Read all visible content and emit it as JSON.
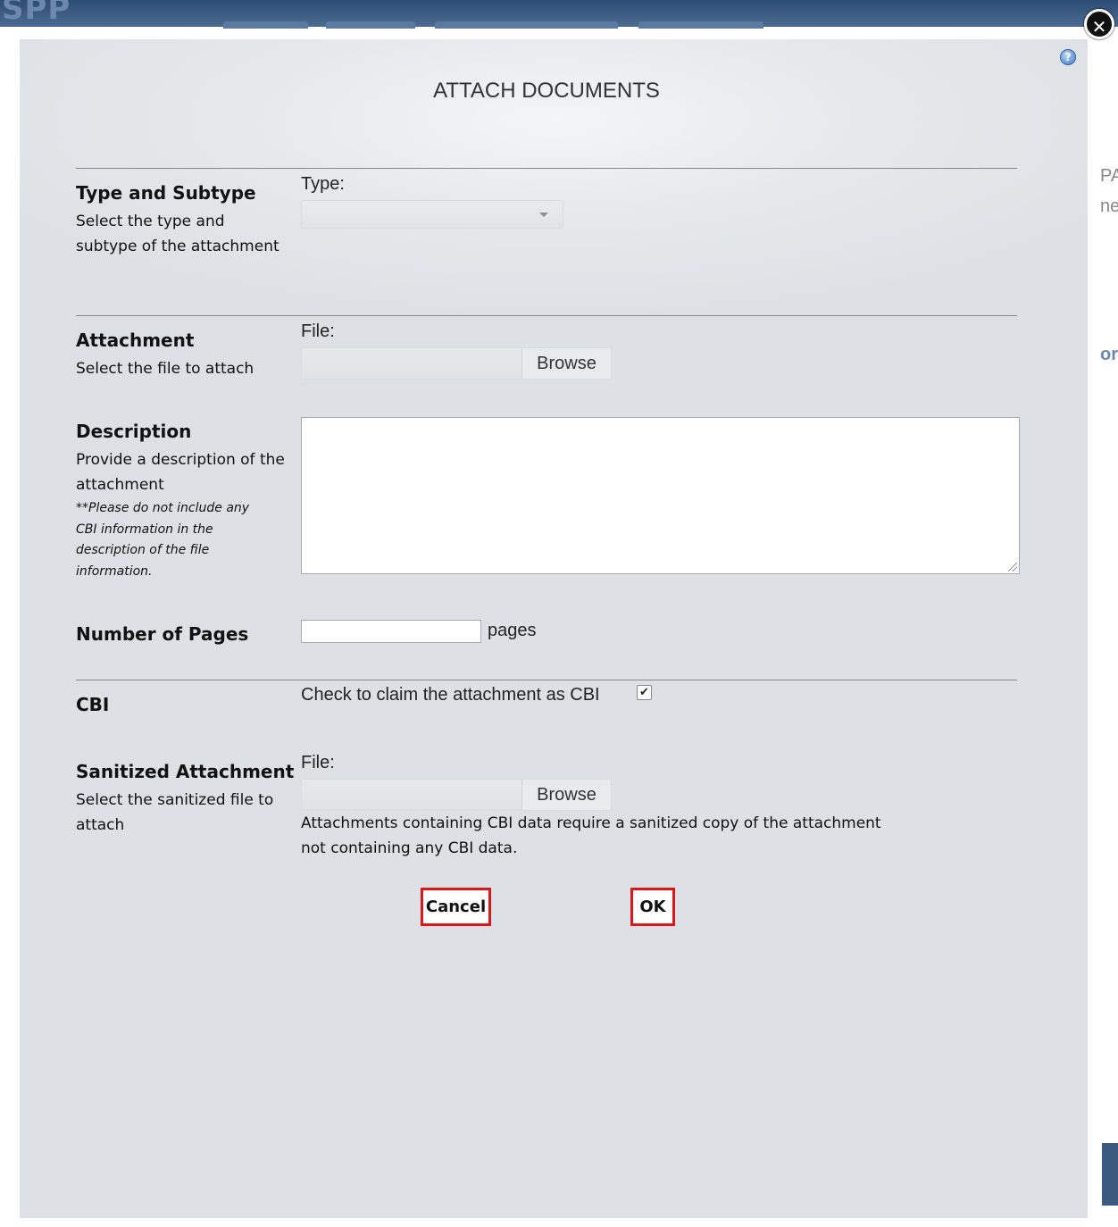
{
  "background": {
    "logo_text": "SPP",
    "right_fragments": [
      "PA",
      "ne",
      "or"
    ]
  },
  "dialog": {
    "title": "ATTACH DOCUMENTS",
    "help_icon": "question-icon",
    "close_icon": "close-icon"
  },
  "type_section": {
    "heading": "Type and Subtype",
    "description": "Select the type and subtype of the attachment",
    "field_label": "Type:",
    "selected_value": ""
  },
  "attachment_section": {
    "heading": "Attachment",
    "description": "Select the file to attach",
    "field_label": "File:",
    "browse_label": "Browse",
    "file_value": ""
  },
  "description_section": {
    "heading": "Description",
    "description": "Provide a description of the attachment",
    "note": "**Please do not include any CBI information in the description of the file information.",
    "value": ""
  },
  "pages_section": {
    "heading": "Number of Pages",
    "value": "",
    "unit": "pages"
  },
  "cbi_section": {
    "heading": "CBI",
    "checkbox_label": "Check to claim the attachment as CBI",
    "checked": true,
    "check_glyph": "✔"
  },
  "sanitized_section": {
    "heading": "Sanitized Attachment",
    "description": "Select the sanitized file to attach",
    "field_label": "File:",
    "browse_label": "Browse",
    "file_value": "",
    "hint": "Attachments containing CBI data require a sanitized copy of the attachment not containing any CBI data."
  },
  "buttons": {
    "cancel": "Cancel",
    "ok": "OK"
  },
  "colors": {
    "button_border": "#e0161b",
    "modal_bg": "#dde1e5"
  }
}
